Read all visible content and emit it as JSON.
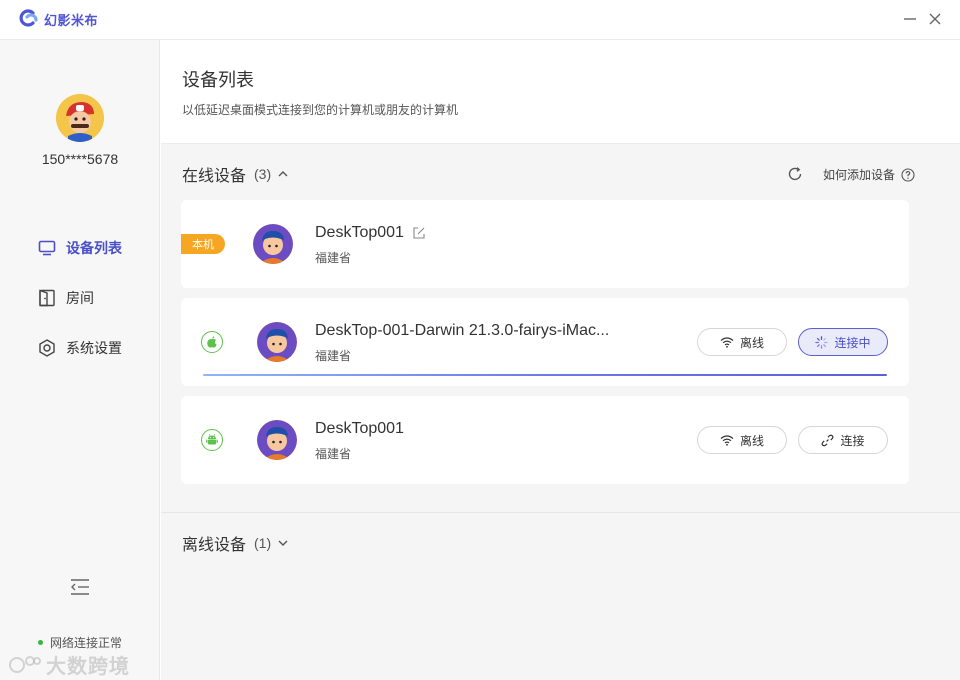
{
  "app": {
    "title": "幻影米布"
  },
  "colors": {
    "accent": "#4b50c8",
    "online_green": "#34b83f",
    "tag_orange": "#f5a623"
  },
  "user": {
    "phone": "150****5678"
  },
  "sidebar": {
    "items": [
      {
        "label": "设备列表",
        "icon": "monitor-icon",
        "active": true
      },
      {
        "label": "房间",
        "icon": "door-icon",
        "active": false
      },
      {
        "label": "系统设置",
        "icon": "settings-hexagon-icon",
        "active": false
      }
    ],
    "network_status": "网络连接正常",
    "watermark": "大数跨境"
  },
  "header": {
    "title": "设备列表",
    "subtitle": "以低延迟桌面模式连接到您的计算机或朋友的计算机"
  },
  "online": {
    "label": "在线设备",
    "count": "(3)",
    "help_label": "如何添加设备",
    "devices": [
      {
        "tag": "本机",
        "name": "DeskTop001",
        "location": "福建省"
      },
      {
        "os": "apple-icon",
        "name": "DeskTop-001-Darwin 21.3.0-fairys-iMac...",
        "location": "福建省",
        "offline_label": "离线",
        "action_label": "连接中",
        "connecting": true
      },
      {
        "os": "android-icon",
        "name": "DeskTop001",
        "location": "福建省",
        "offline_label": "离线",
        "action_label": "连接",
        "connecting": false
      }
    ]
  },
  "offline": {
    "label": "离线设备",
    "count": "(1)"
  }
}
